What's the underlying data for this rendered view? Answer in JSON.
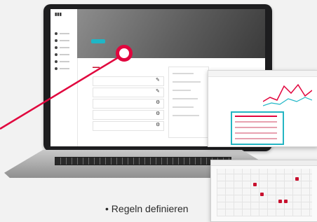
{
  "caption": {
    "bullet": "•",
    "text": "Regeln definieren"
  },
  "colors": {
    "accent": "#e1063e",
    "teal": "#1fb6c6",
    "brand_red": "#c8102e"
  },
  "icons": {
    "rule_action": "pencil-icon",
    "callout": "circle-marker-icon"
  }
}
